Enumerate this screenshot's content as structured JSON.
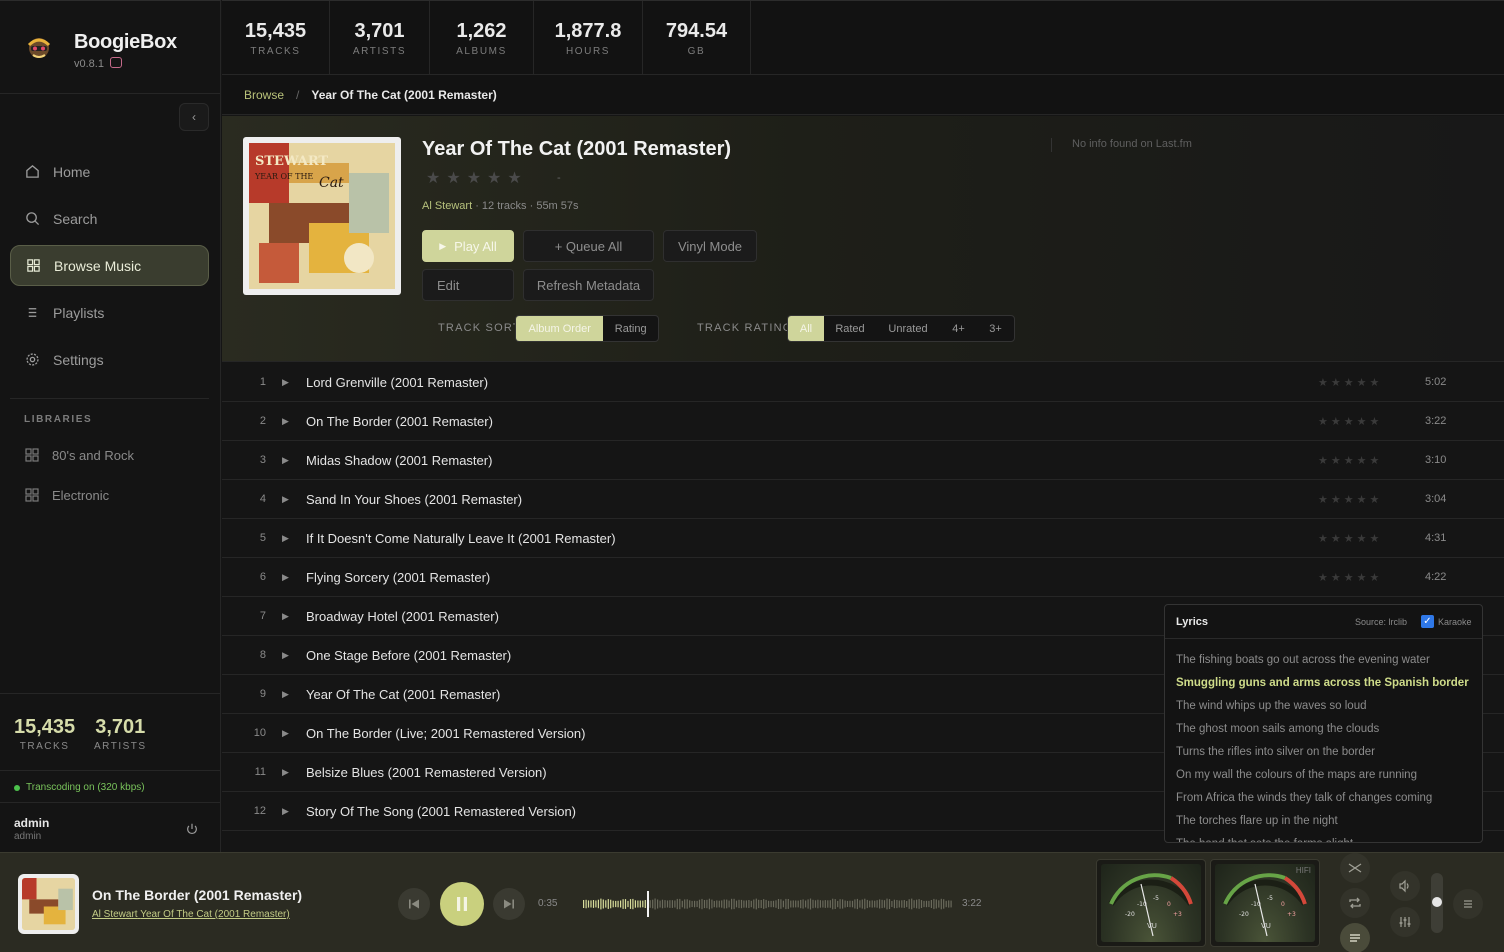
{
  "app": {
    "name": "BoogieBox",
    "version": "v0.8.1"
  },
  "nav": [
    {
      "label": "Home",
      "icon": "home-icon"
    },
    {
      "label": "Search",
      "icon": "search-icon"
    },
    {
      "label": "Browse Music",
      "icon": "grid-icon",
      "active": true
    },
    {
      "label": "Playlists",
      "icon": "list-icon"
    },
    {
      "label": "Settings",
      "icon": "gear-icon"
    }
  ],
  "libraries": {
    "title": "LIBRARIES",
    "items": [
      "80's and Rock",
      "Electronic"
    ]
  },
  "side_stats": [
    {
      "value": "15,435",
      "label": "TRACKS"
    },
    {
      "value": "3,701",
      "label": "ARTISTS"
    }
  ],
  "transcoding": "Transcoding on (320 kbps)",
  "user": {
    "name": "admin",
    "role": "admin"
  },
  "top_stats": [
    {
      "value": "15,435",
      "label": "TRACKS"
    },
    {
      "value": "3,701",
      "label": "ARTISTS"
    },
    {
      "value": "1,262",
      "label": "ALBUMS"
    },
    {
      "value": "1,877.8",
      "label": "HOURS"
    },
    {
      "value": "794.54",
      "label": "GB"
    }
  ],
  "breadcrumb": {
    "link": "Browse",
    "sep": "/",
    "current": "Year Of The Cat (2001 Remaster)"
  },
  "album": {
    "title": "Year Of The Cat (2001 Remaster)",
    "stars": "★★★★★",
    "rating_dash": "-",
    "artist": "Al Stewart",
    "info": " · 12 tracks · 55m 57s",
    "lastfm": "No info found on Last.fm",
    "buttons": {
      "play_all": "Play All",
      "queue_all": "+ Queue All",
      "vinyl": "Vinyl Mode",
      "edit": "Edit",
      "refresh": "Refresh Metadata"
    },
    "track_sort": {
      "label": "TRACK SORT",
      "options": [
        "Album Order",
        "Rating"
      ],
      "selected": "Album Order"
    },
    "track_rating": {
      "label": "TRACK RATING",
      "options": [
        "All",
        "Rated",
        "Unrated",
        "4+",
        "3+"
      ],
      "selected": "All"
    }
  },
  "tracks": [
    {
      "n": "1",
      "title": "Lord Grenville (2001 Remaster)",
      "dur": "5:02"
    },
    {
      "n": "2",
      "title": "On The Border (2001 Remaster)",
      "dur": "3:22"
    },
    {
      "n": "3",
      "title": "Midas Shadow (2001 Remaster)",
      "dur": "3:10"
    },
    {
      "n": "4",
      "title": "Sand In Your Shoes (2001 Remaster)",
      "dur": "3:04"
    },
    {
      "n": "5",
      "title": "If It Doesn't Come Naturally Leave It (2001 Remaster)",
      "dur": "4:31"
    },
    {
      "n": "6",
      "title": "Flying Sorcery (2001 Remaster)",
      "dur": "4:22"
    },
    {
      "n": "7",
      "title": "Broadway Hotel (2001 Remaster)",
      "dur": ""
    },
    {
      "n": "8",
      "title": "One Stage Before (2001 Remaster)",
      "dur": ""
    },
    {
      "n": "9",
      "title": "Year Of The Cat (2001 Remaster)",
      "dur": ""
    },
    {
      "n": "10",
      "title": "On The Border (Live; 2001 Remastered Version)",
      "dur": ""
    },
    {
      "n": "11",
      "title": "Belsize Blues (2001 Remastered Version)",
      "dur": ""
    },
    {
      "n": "12",
      "title": "Story Of The Song (2001 Remastered Version)",
      "dur": ""
    }
  ],
  "lyrics": {
    "title": "Lyrics",
    "source": "Source: lrclib",
    "karaoke": "Karaoke",
    "current_index": 1,
    "lines": [
      "The fishing boats go out across the evening water",
      "Smuggling guns and arms across the Spanish border",
      "The wind whips up the waves so loud",
      "The ghost moon sails among the clouds",
      "Turns the rifles into silver on the border",
      "On my wall the colours of the maps are running",
      "From Africa the winds they talk of changes coming",
      "The torches flare up in the night",
      "The hand that sets the farms alight"
    ]
  },
  "player": {
    "title": "On The Border (2001 Remaster)",
    "artist": "Al Stewart",
    "album": "Year Of The Cat (2001 Remaster)",
    "elapsed": "0:35",
    "duration": "3:22",
    "progress": 0.173,
    "state": "playing",
    "vu_badge": "HIFI"
  },
  "colors": {
    "accent": "#cfd59b",
    "accent_text": "#b9c27a",
    "player_bg": "#2b2b22"
  }
}
